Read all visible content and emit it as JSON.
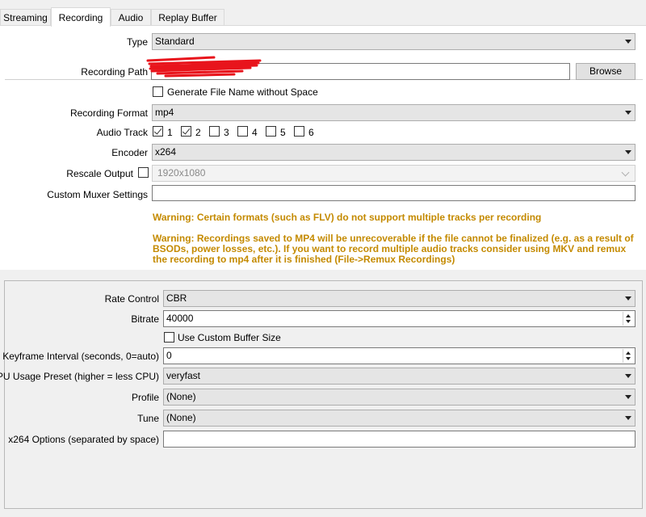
{
  "tabs": [
    {
      "label": "Streaming",
      "active": false
    },
    {
      "label": "Recording",
      "active": true
    },
    {
      "label": "Audio",
      "active": false
    },
    {
      "label": "Replay Buffer",
      "active": false
    }
  ],
  "recording": {
    "type": {
      "label": "Type",
      "value": "Standard"
    },
    "path": {
      "label": "Recording Path",
      "value": "",
      "browse_label": "Browse"
    },
    "generate_name": {
      "label": "Generate File Name without Space",
      "checked": false
    },
    "format": {
      "label": "Recording Format",
      "value": "mp4"
    },
    "audio_track": {
      "label": "Audio Track",
      "tracks": [
        {
          "label": "1",
          "checked": true
        },
        {
          "label": "2",
          "checked": true
        },
        {
          "label": "3",
          "checked": false
        },
        {
          "label": "4",
          "checked": false
        },
        {
          "label": "5",
          "checked": false
        },
        {
          "label": "6",
          "checked": false
        }
      ]
    },
    "encoder": {
      "label": "Encoder",
      "value": "x264"
    },
    "rescale": {
      "label": "Rescale Output",
      "checked": false,
      "value": "1920x1080"
    },
    "muxer": {
      "label": "Custom Muxer Settings",
      "value": ""
    },
    "warning1": "Warning: Certain formats (such as FLV) do not support multiple tracks per recording",
    "warning2": "Warning: Recordings saved to MP4 will be unrecoverable if the file cannot be finalized (e.g. as a result of BSODs, power losses, etc.). If you want to record multiple audio tracks consider using MKV and remux the recording to mp4 after it is finished (File->Remux Recordings)"
  },
  "encoder_settings": {
    "rate_control": {
      "label": "Rate Control",
      "value": "CBR"
    },
    "bitrate": {
      "label": "Bitrate",
      "value": "40000"
    },
    "custom_buffer": {
      "label": "Use Custom Buffer Size",
      "checked": false
    },
    "keyframe": {
      "label": "Keyframe Interval (seconds, 0=auto)",
      "value": "0"
    },
    "cpu_preset": {
      "label": "CPU Usage Preset (higher = less CPU)",
      "value": "veryfast"
    },
    "profile": {
      "label": "Profile",
      "value": "(None)"
    },
    "tune": {
      "label": "Tune",
      "value": "(None)"
    },
    "x264_options": {
      "label": "x264 Options (separated by space)",
      "value": ""
    }
  },
  "colors": {
    "warning": "#c48a00",
    "redaction": "#e8141c"
  }
}
